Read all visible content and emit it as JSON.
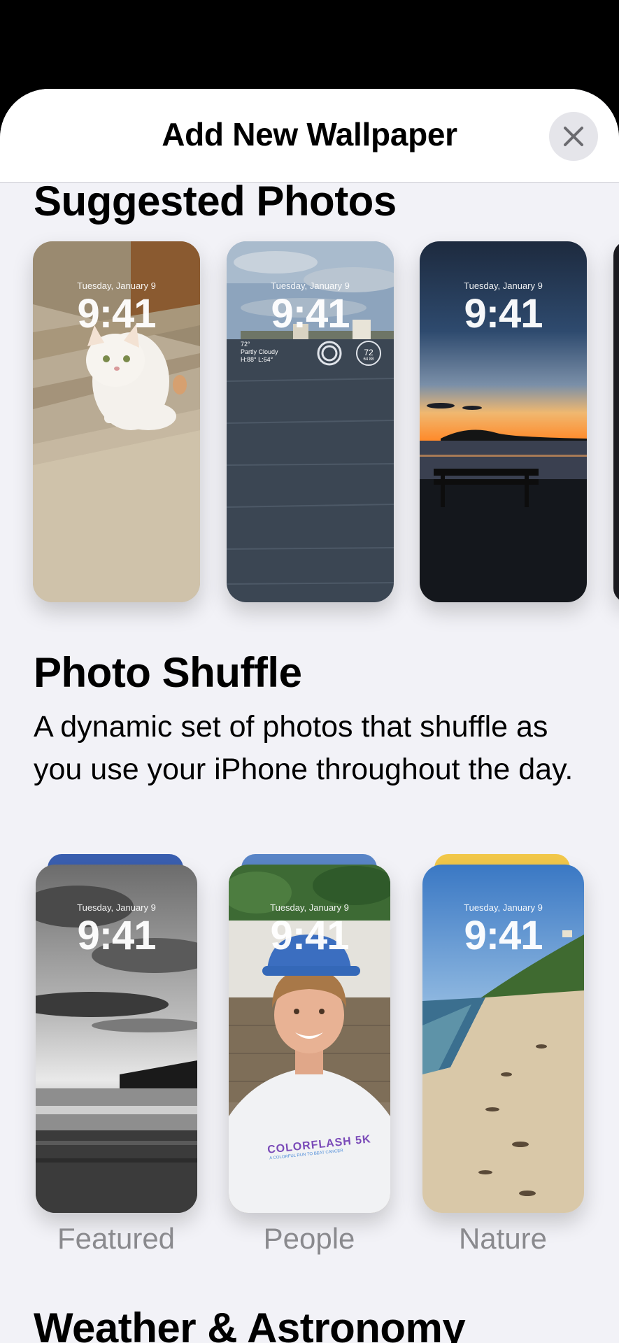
{
  "header": {
    "title": "Add New Wallpaper"
  },
  "suggested": {
    "title": "Suggested Photos",
    "cards": [
      {
        "date": "Tuesday, January 9",
        "time": "9:41"
      },
      {
        "date": "Tuesday, January 9",
        "time": "9:41",
        "weather_line1": "72°",
        "weather_line2": "Partly Cloudy",
        "weather_line3": "H:88° L:64°",
        "ring_value": "72",
        "ring_sub": "64 88"
      },
      {
        "date": "Tuesday, January 9",
        "time": "9:41"
      }
    ]
  },
  "shuffle": {
    "title": "Photo Shuffle",
    "description": "A dynamic set of photos that shuffle as you use your iPhone throughout the day.",
    "cards": [
      {
        "date": "Tuesday, January 9",
        "time": "9:41",
        "label": "Featured"
      },
      {
        "date": "Tuesday, January 9",
        "time": "9:41",
        "label": "People",
        "shirt_text": "COLORFLASH 5K",
        "shirt_sub": "A COLORFUL RUN TO BEAT CANCER"
      },
      {
        "date": "Tuesday, January 9",
        "time": "9:41",
        "label": "Nature"
      }
    ]
  },
  "weather": {
    "title": "Weather & Astronomy"
  }
}
